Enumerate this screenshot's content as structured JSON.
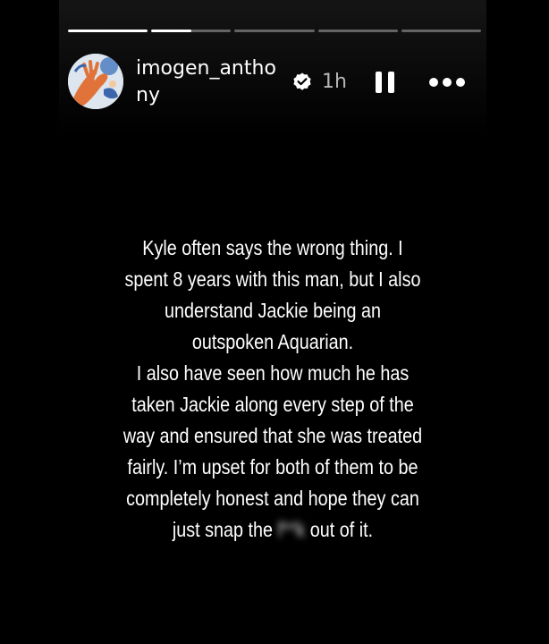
{
  "story": {
    "progress": [
      1,
      0.5,
      0,
      0,
      0
    ],
    "username": "imogen_anthony",
    "verified_icon": "verified-badge-icon",
    "time": "1h",
    "pause_icon": "pause-icon",
    "more_icon": "more-options-icon",
    "avatar_icon": "avatar-illustration",
    "caption_lines": [
      "Kyle often says the wrong thing. I",
      "spent 8 years with this man, but I also",
      "understand Jackie being an",
      "outspoken Aquarian.",
      "I also have seen how much he has",
      "taken Jackie along every step of the",
      "way and ensured that she was treated",
      "fairly. I’m upset for both of them to be",
      "completely honest and hope they can"
    ],
    "caption_last": {
      "before": "just snap the",
      "censored": "f**k",
      "after": "out of it."
    },
    "colors": {
      "background": "#000000",
      "text": "#ffffff",
      "progress_track": "#5a5a5a"
    }
  }
}
